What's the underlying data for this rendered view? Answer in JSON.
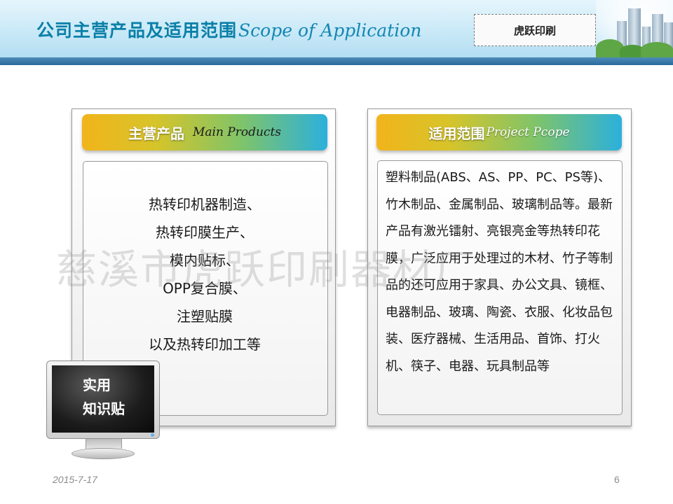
{
  "header": {
    "title_cn": "公司主营产品及适用范围",
    "title_en": "Scope of Application",
    "brand": "虎跃印刷"
  },
  "left_panel": {
    "ribbon_cn": "主营产品",
    "ribbon_en": "Main Products",
    "items": [
      "热转印机器制造、",
      "热转印膜生产、",
      "模内贴标、",
      "OPP复合膜、",
      "注塑贴膜",
      "以及热转印加工等"
    ]
  },
  "right_panel": {
    "ribbon_cn": "适用范围",
    "ribbon_en": "Project Pcope",
    "text": "塑料制品(ABS、AS、PP、PC、PS等)、竹木制品、金属制品、玻璃制品等。最新产品有激光镭射、亮银亮金等热转印花膜，广泛应用于处理过的木材、竹子等制品的还可应用于家具、办公文具、镜框、电器制品、玻璃、陶瓷、衣服、化妆品包装、医疗器械、生活用品、首饰、打火机、筷子、电器、玩具制品等"
  },
  "watermark": "慈溪市虎跃印刷器材厂",
  "monitor": {
    "line1": "实用",
    "line2": "知识贴"
  },
  "footer": {
    "date": "2015-7-17",
    "page": "6"
  }
}
